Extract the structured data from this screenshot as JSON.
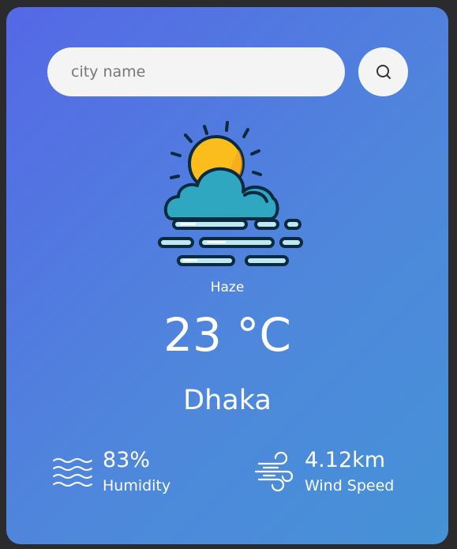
{
  "search": {
    "placeholder": "city name",
    "button_icon": "search-icon"
  },
  "weather": {
    "icon": "haze-icon",
    "condition": "Haze",
    "temperature": "23 °C",
    "city": "Dhaka"
  },
  "stats": {
    "humidity": {
      "icon": "humidity-waves-icon",
      "value": "83%",
      "label": "Humidity"
    },
    "wind": {
      "icon": "wind-icon",
      "value": "4.12km",
      "label": "Wind Speed"
    }
  },
  "colors": {
    "card_gradient_start": "#5568e6",
    "card_gradient_end": "#4592d6",
    "sun": "#fbbd1c",
    "cloud": "#2fa7c0",
    "outline": "#0b2a40"
  }
}
